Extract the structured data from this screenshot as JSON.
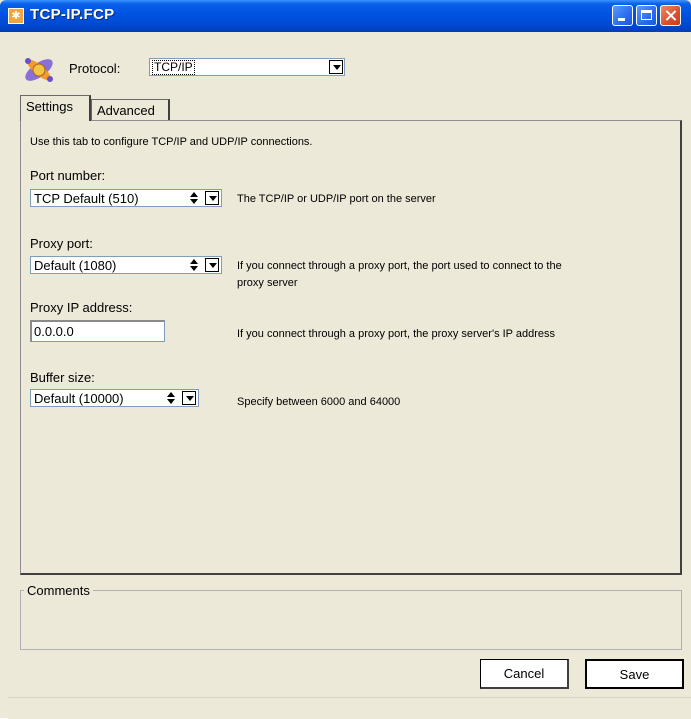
{
  "window": {
    "title": "TCP-IP.FCP"
  },
  "protocol": {
    "label": "Protocol:",
    "value": "TCP/IP"
  },
  "tabs": [
    {
      "label": "Settings",
      "active": true
    },
    {
      "label": "Advanced",
      "active": false
    }
  ],
  "settings": {
    "description": "Use this tab to configure TCP/IP and UDP/IP connections.",
    "port_number": {
      "label": "Port number:",
      "value": "TCP Default (510)",
      "help": "The TCP/IP or UDP/IP port on the server"
    },
    "proxy_port": {
      "label": "Proxy port:",
      "value": "Default (1080)",
      "help_line1": "If you connect through a proxy port, the port used to connect to the",
      "help_line2": "proxy server"
    },
    "proxy_ip": {
      "label": "Proxy IP address:",
      "value": "0.0.0.0",
      "help": "If you connect through a proxy port, the proxy server's IP address"
    },
    "buffer_size": {
      "label": "Buffer size:",
      "value": "Default (10000)",
      "help": "Specify between 6000 and 64000"
    }
  },
  "comments": {
    "label": "Comments",
    "value": ""
  },
  "buttons": {
    "cancel": "Cancel",
    "save": "Save"
  },
  "colors": {
    "titlebar": "#0054e3",
    "window_bg": "#ece9d8",
    "close_button": "#d9502e"
  }
}
